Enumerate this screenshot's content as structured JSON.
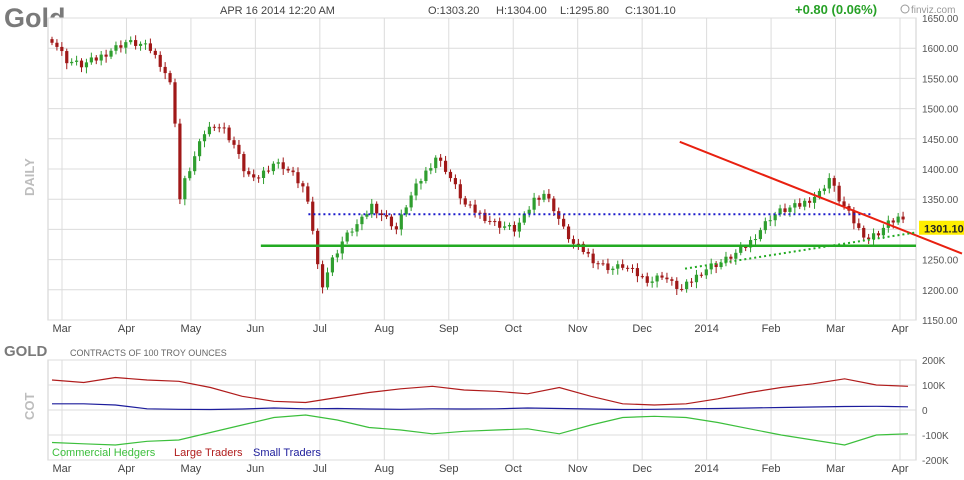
{
  "header": {
    "symbol": "Gold",
    "datetime": "APR 16 2014 12:20 AM",
    "open": "O:1303.20",
    "high": "H:1304.00",
    "low": "L:1295.80",
    "close": "C:1301.10",
    "change": "+0.80 (0.06%)",
    "brand": "finviz.com"
  },
  "colors": {
    "up": "#2f9e2f",
    "down": "#a01818",
    "change": "#27a127",
    "support": "#22aa22",
    "resistance": "#e82010",
    "dotted_blue": "#1a1acc",
    "commercial": "#3cbf3c",
    "large": "#b01c1c",
    "small": "#1c1c9c",
    "grid": "#dcdcdc",
    "price_badge": "#ffee00"
  },
  "chart_data": [
    {
      "type": "candlestick",
      "panel": "price",
      "side_label": "DAILY",
      "ylim": [
        1150,
        1650
      ],
      "yticks": [
        1150,
        1200,
        1250,
        1300,
        1350,
        1400,
        1450,
        1500,
        1550,
        1600,
        1650
      ],
      "ytick_labels": [
        "1150.00",
        "1200.00",
        "1250.00",
        "1300.00",
        "1350.00",
        "1400.00",
        "1450.00",
        "1500.00",
        "1550.00",
        "1600.00",
        "1650.00"
      ],
      "x_months": [
        "Mar",
        "Apr",
        "May",
        "Jun",
        "Jul",
        "Aug",
        "Sep",
        "Oct",
        "Nov",
        "Dec",
        "2014",
        "Feb",
        "Mar",
        "Apr"
      ],
      "last_price": "1301.10",
      "close_path": [
        [
          0,
          1615
        ],
        [
          3,
          1580
        ],
        [
          6,
          1572
        ],
        [
          9,
          1582
        ],
        [
          12,
          1597
        ],
        [
          15,
          1610
        ],
        [
          18,
          1606
        ],
        [
          20,
          1598
        ],
        [
          22,
          1575
        ],
        [
          23,
          1560
        ],
        [
          24,
          1540
        ],
        [
          25,
          1480
        ],
        [
          26,
          1350
        ],
        [
          27,
          1380
        ],
        [
          29,
          1420
        ],
        [
          31,
          1460
        ],
        [
          33,
          1475
        ],
        [
          35,
          1465
        ],
        [
          37,
          1440
        ],
        [
          39,
          1400
        ],
        [
          41,
          1380
        ],
        [
          43,
          1395
        ],
        [
          45,
          1410
        ],
        [
          47,
          1405
        ],
        [
          49,
          1390
        ],
        [
          51,
          1370
        ],
        [
          52,
          1340
        ],
        [
          53,
          1300
        ],
        [
          54,
          1240
        ],
        [
          55,
          1210
        ],
        [
          56,
          1230
        ],
        [
          57,
          1250
        ],
        [
          59,
          1280
        ],
        [
          61,
          1300
        ],
        [
          63,
          1315
        ],
        [
          65,
          1340
        ],
        [
          67,
          1325
        ],
        [
          69,
          1310
        ],
        [
          70,
          1300
        ],
        [
          72,
          1340
        ],
        [
          74,
          1370
        ],
        [
          76,
          1395
        ],
        [
          78,
          1420
        ],
        [
          80,
          1400
        ],
        [
          82,
          1370
        ],
        [
          84,
          1340
        ],
        [
          86,
          1330
        ],
        [
          88,
          1320
        ],
        [
          90,
          1310
        ],
        [
          92,
          1305
        ],
        [
          94,
          1300
        ],
        [
          96,
          1320
        ],
        [
          98,
          1350
        ],
        [
          100,
          1360
        ],
        [
          102,
          1335
        ],
        [
          104,
          1300
        ],
        [
          106,
          1275
        ],
        [
          108,
          1265
        ],
        [
          110,
          1250
        ],
        [
          112,
          1240
        ],
        [
          114,
          1235
        ],
        [
          116,
          1240
        ],
        [
          118,
          1230
        ],
        [
          120,
          1220
        ],
        [
          122,
          1215
        ],
        [
          124,
          1225
        ],
        [
          126,
          1210
        ],
        [
          128,
          1200
        ],
        [
          130,
          1215
        ],
        [
          132,
          1230
        ],
        [
          134,
          1240
        ],
        [
          136,
          1245
        ],
        [
          138,
          1255
        ],
        [
          140,
          1265
        ],
        [
          142,
          1280
        ],
        [
          144,
          1300
        ],
        [
          146,
          1320
        ],
        [
          148,
          1330
        ],
        [
          150,
          1335
        ],
        [
          152,
          1340
        ],
        [
          154,
          1350
        ],
        [
          156,
          1360
        ],
        [
          158,
          1385
        ],
        [
          160,
          1350
        ],
        [
          162,
          1325
        ],
        [
          164,
          1300
        ],
        [
          166,
          1285
        ],
        [
          168,
          1295
        ],
        [
          170,
          1310
        ],
        [
          172,
          1320
        ],
        [
          174,
          1301
        ]
      ],
      "trendlines": [
        {
          "kind": "horizontal-support",
          "value": 1273,
          "from": 0.13,
          "to": 1.0
        },
        {
          "kind": "dotted-resistance",
          "value": 1325,
          "from": 0.3,
          "to": 0.95
        },
        {
          "kind": "falling-resistance",
          "from_value": 1445,
          "to_value": 1285,
          "from": 0.82,
          "to": 1.0
        },
        {
          "kind": "dotted-rising",
          "from_value": 1235,
          "to_value": 1295,
          "from": 0.78,
          "to": 1.0
        }
      ]
    },
    {
      "type": "line",
      "panel": "cot",
      "title": "GOLD",
      "subtitle": "CONTRACTS OF 100 TROY OUNCES",
      "side_label": "COT",
      "ylim": [
        -200000,
        200000
      ],
      "yticks": [
        200000,
        100000,
        0,
        -100000,
        -200000
      ],
      "ytick_labels": [
        "200K",
        "100K",
        "0",
        "-100K",
        "-200K"
      ],
      "x_months": [
        "Mar",
        "Apr",
        "May",
        "Jun",
        "Jul",
        "Aug",
        "Sep",
        "Oct",
        "Nov",
        "Dec",
        "2014",
        "Feb",
        "Mar",
        "Apr"
      ],
      "series": [
        {
          "name": "Commercial Hedgers",
          "key": "commercial",
          "values": [
            -130000,
            -135000,
            -140000,
            -125000,
            -120000,
            -90000,
            -60000,
            -30000,
            -20000,
            -40000,
            -70000,
            -80000,
            -95000,
            -85000,
            -80000,
            -75000,
            -95000,
            -60000,
            -30000,
            -25000,
            -30000,
            -50000,
            -75000,
            -100000,
            -120000,
            -140000,
            -100000,
            -95000
          ]
        },
        {
          "name": "Large Traders",
          "key": "large",
          "values": [
            120000,
            110000,
            130000,
            120000,
            115000,
            90000,
            55000,
            35000,
            30000,
            50000,
            70000,
            85000,
            95000,
            80000,
            75000,
            65000,
            90000,
            55000,
            25000,
            20000,
            25000,
            45000,
            70000,
            90000,
            105000,
            125000,
            100000,
            95000
          ]
        },
        {
          "name": "Small Traders",
          "key": "small",
          "values": [
            25000,
            25000,
            20000,
            5000,
            3000,
            2000,
            4000,
            8000,
            5000,
            6000,
            4000,
            3000,
            5000,
            4000,
            5000,
            8000,
            6000,
            4000,
            2000,
            3000,
            5000,
            6000,
            8000,
            10000,
            12000,
            14000,
            15000,
            13000
          ]
        }
      ]
    }
  ]
}
